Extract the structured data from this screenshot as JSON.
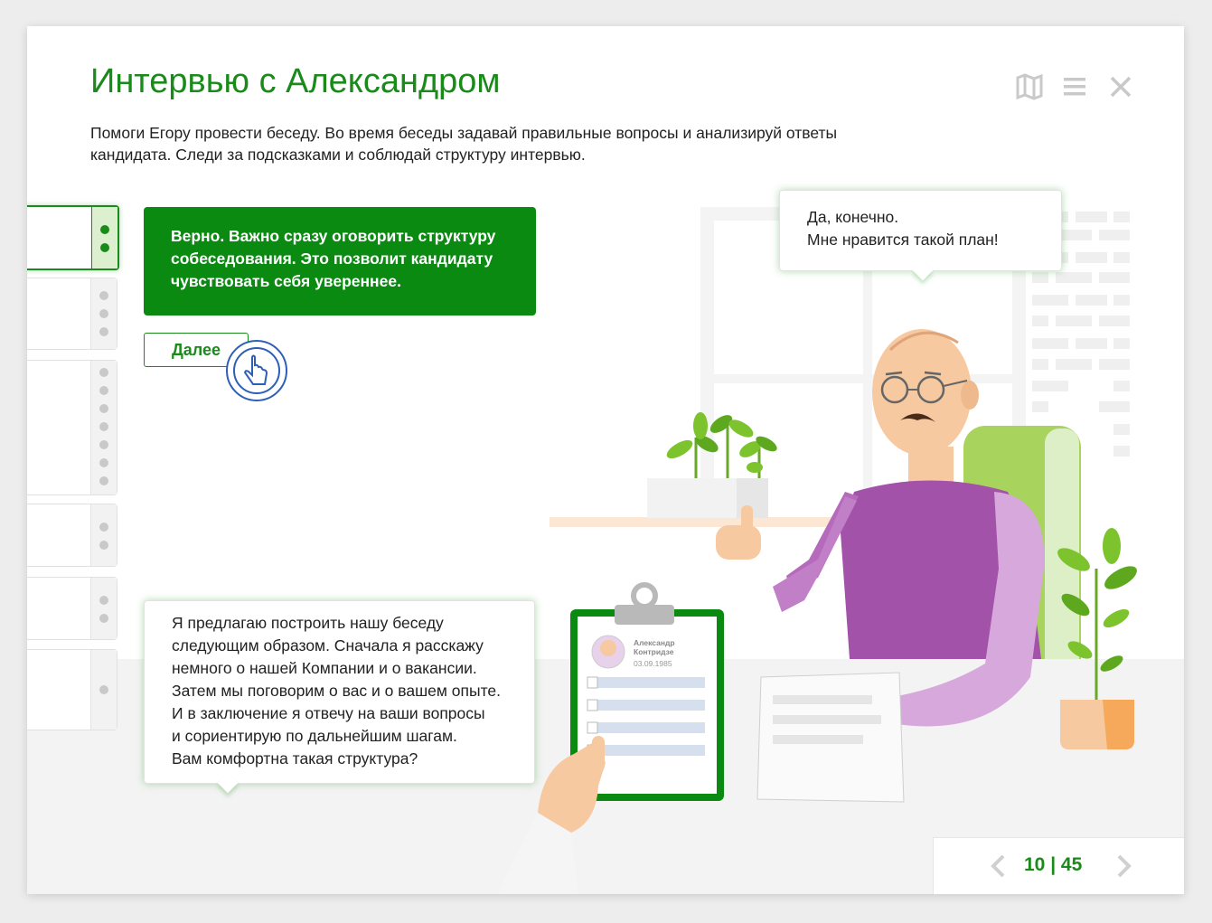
{
  "header": {
    "title": "Интервью с Александром",
    "subtitle": "Помоги Егору провести беседу. Во время беседы задавай правильные вопросы и анализируй ответы кандидата. Следи за подсказками и соблюдай структуру интервью.",
    "icons": [
      "map-icon",
      "menu-icon",
      "close-icon"
    ]
  },
  "feedback": {
    "text": "Верно. Важно сразу оговорить структуру собеседования. Это позволит кандидату чувствовать себя увереннее.",
    "next_label": "Далее"
  },
  "candidate_bubble": {
    "line1": "Да, конечно.",
    "line2": "Мне нравится такой план!"
  },
  "interviewer_bubble": {
    "lines": [
      "Я предлагаю построить нашу беседу",
      "следующим образом. Сначала я расскажу",
      "немного о нашей Компании и о вакансии.",
      "Затем мы поговорим о вас и о вашем опыте.",
      "И в заключение я отвечу на ваши вопросы",
      "и сориентирую по дальнейшим шагам.",
      "Вам комфортна такая структура?"
    ]
  },
  "document": {
    "first_name": "Александр",
    "last_name": "Контридзе",
    "date": "03.09.1985"
  },
  "pager": {
    "counter": "10 | 45"
  },
  "colors": {
    "brand_green": "#1a8a1a",
    "feedback_bg": "#0b8a12",
    "shirt": "#a252a8"
  }
}
